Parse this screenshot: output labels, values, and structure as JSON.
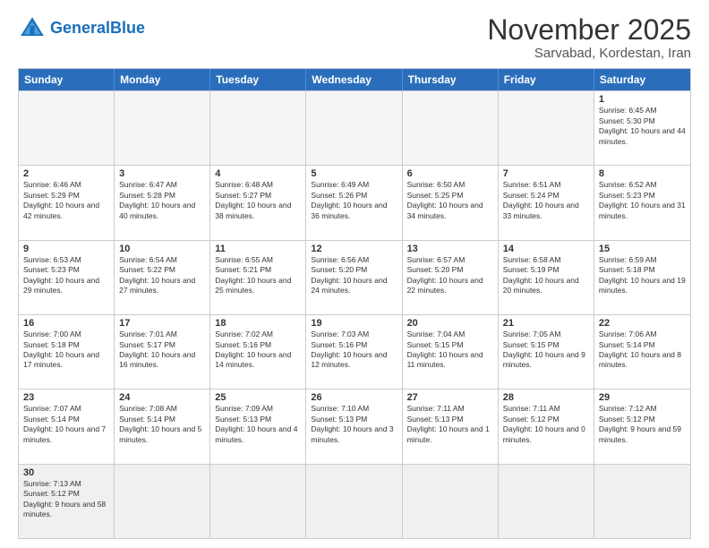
{
  "header": {
    "logo_general": "General",
    "logo_blue": "Blue",
    "month_year": "November 2025",
    "location": "Sarvabad, Kordestan, Iran"
  },
  "days_of_week": [
    "Sunday",
    "Monday",
    "Tuesday",
    "Wednesday",
    "Thursday",
    "Friday",
    "Saturday"
  ],
  "weeks": [
    [
      {
        "day": "",
        "info": ""
      },
      {
        "day": "",
        "info": ""
      },
      {
        "day": "",
        "info": ""
      },
      {
        "day": "",
        "info": ""
      },
      {
        "day": "",
        "info": ""
      },
      {
        "day": "",
        "info": ""
      },
      {
        "day": "1",
        "info": "Sunrise: 6:45 AM\nSunset: 5:30 PM\nDaylight: 10 hours and 44 minutes."
      }
    ],
    [
      {
        "day": "2",
        "info": "Sunrise: 6:46 AM\nSunset: 5:29 PM\nDaylight: 10 hours and 42 minutes."
      },
      {
        "day": "3",
        "info": "Sunrise: 6:47 AM\nSunset: 5:28 PM\nDaylight: 10 hours and 40 minutes."
      },
      {
        "day": "4",
        "info": "Sunrise: 6:48 AM\nSunset: 5:27 PM\nDaylight: 10 hours and 38 minutes."
      },
      {
        "day": "5",
        "info": "Sunrise: 6:49 AM\nSunset: 5:26 PM\nDaylight: 10 hours and 36 minutes."
      },
      {
        "day": "6",
        "info": "Sunrise: 6:50 AM\nSunset: 5:25 PM\nDaylight: 10 hours and 34 minutes."
      },
      {
        "day": "7",
        "info": "Sunrise: 6:51 AM\nSunset: 5:24 PM\nDaylight: 10 hours and 33 minutes."
      },
      {
        "day": "8",
        "info": "Sunrise: 6:52 AM\nSunset: 5:23 PM\nDaylight: 10 hours and 31 minutes."
      }
    ],
    [
      {
        "day": "9",
        "info": "Sunrise: 6:53 AM\nSunset: 5:23 PM\nDaylight: 10 hours and 29 minutes."
      },
      {
        "day": "10",
        "info": "Sunrise: 6:54 AM\nSunset: 5:22 PM\nDaylight: 10 hours and 27 minutes."
      },
      {
        "day": "11",
        "info": "Sunrise: 6:55 AM\nSunset: 5:21 PM\nDaylight: 10 hours and 25 minutes."
      },
      {
        "day": "12",
        "info": "Sunrise: 6:56 AM\nSunset: 5:20 PM\nDaylight: 10 hours and 24 minutes."
      },
      {
        "day": "13",
        "info": "Sunrise: 6:57 AM\nSunset: 5:20 PM\nDaylight: 10 hours and 22 minutes."
      },
      {
        "day": "14",
        "info": "Sunrise: 6:58 AM\nSunset: 5:19 PM\nDaylight: 10 hours and 20 minutes."
      },
      {
        "day": "15",
        "info": "Sunrise: 6:59 AM\nSunset: 5:18 PM\nDaylight: 10 hours and 19 minutes."
      }
    ],
    [
      {
        "day": "16",
        "info": "Sunrise: 7:00 AM\nSunset: 5:18 PM\nDaylight: 10 hours and 17 minutes."
      },
      {
        "day": "17",
        "info": "Sunrise: 7:01 AM\nSunset: 5:17 PM\nDaylight: 10 hours and 16 minutes."
      },
      {
        "day": "18",
        "info": "Sunrise: 7:02 AM\nSunset: 5:16 PM\nDaylight: 10 hours and 14 minutes."
      },
      {
        "day": "19",
        "info": "Sunrise: 7:03 AM\nSunset: 5:16 PM\nDaylight: 10 hours and 12 minutes."
      },
      {
        "day": "20",
        "info": "Sunrise: 7:04 AM\nSunset: 5:15 PM\nDaylight: 10 hours and 11 minutes."
      },
      {
        "day": "21",
        "info": "Sunrise: 7:05 AM\nSunset: 5:15 PM\nDaylight: 10 hours and 9 minutes."
      },
      {
        "day": "22",
        "info": "Sunrise: 7:06 AM\nSunset: 5:14 PM\nDaylight: 10 hours and 8 minutes."
      }
    ],
    [
      {
        "day": "23",
        "info": "Sunrise: 7:07 AM\nSunset: 5:14 PM\nDaylight: 10 hours and 7 minutes."
      },
      {
        "day": "24",
        "info": "Sunrise: 7:08 AM\nSunset: 5:14 PM\nDaylight: 10 hours and 5 minutes."
      },
      {
        "day": "25",
        "info": "Sunrise: 7:09 AM\nSunset: 5:13 PM\nDaylight: 10 hours and 4 minutes."
      },
      {
        "day": "26",
        "info": "Sunrise: 7:10 AM\nSunset: 5:13 PM\nDaylight: 10 hours and 3 minutes."
      },
      {
        "day": "27",
        "info": "Sunrise: 7:11 AM\nSunset: 5:13 PM\nDaylight: 10 hours and 1 minute."
      },
      {
        "day": "28",
        "info": "Sunrise: 7:11 AM\nSunset: 5:12 PM\nDaylight: 10 hours and 0 minutes."
      },
      {
        "day": "29",
        "info": "Sunrise: 7:12 AM\nSunset: 5:12 PM\nDaylight: 9 hours and 59 minutes."
      }
    ],
    [
      {
        "day": "30",
        "info": "Sunrise: 7:13 AM\nSunset: 5:12 PM\nDaylight: 9 hours and 58 minutes."
      },
      {
        "day": "",
        "info": ""
      },
      {
        "day": "",
        "info": ""
      },
      {
        "day": "",
        "info": ""
      },
      {
        "day": "",
        "info": ""
      },
      {
        "day": "",
        "info": ""
      },
      {
        "day": "",
        "info": ""
      }
    ]
  ]
}
